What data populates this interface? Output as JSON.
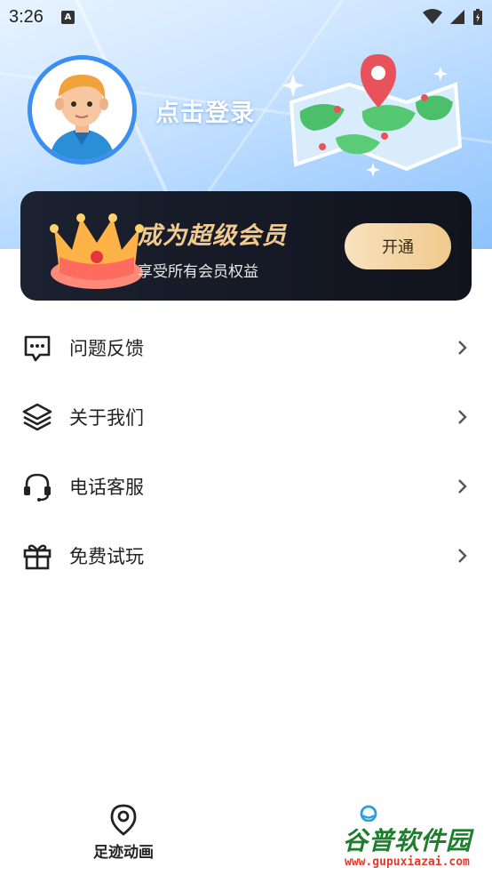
{
  "status_bar": {
    "time": "3:26",
    "notification_icon": "A"
  },
  "header": {
    "login_text": "点击登录"
  },
  "vip": {
    "title": "成为超级会员",
    "subtitle": "享受所有会员权益",
    "button_label": "开通"
  },
  "menu": {
    "items": [
      {
        "label": "问题反馈",
        "icon": "chat-bubble-icon"
      },
      {
        "label": "关于我们",
        "icon": "layers-icon"
      },
      {
        "label": "电话客服",
        "icon": "headset-icon"
      },
      {
        "label": "免费试玩",
        "icon": "gift-icon"
      }
    ]
  },
  "tabbar": {
    "tabs": [
      {
        "label": "足迹动画",
        "icon": "location-pin-icon"
      },
      {
        "label": "",
        "icon": "user-icon"
      }
    ]
  },
  "watermark": {
    "title": "谷普软件园",
    "url": "www.gupuxiazai.com"
  },
  "colors": {
    "accent": "#3b8ef2",
    "vip_gold": "#f2c98f",
    "vip_bg": "#141824"
  }
}
